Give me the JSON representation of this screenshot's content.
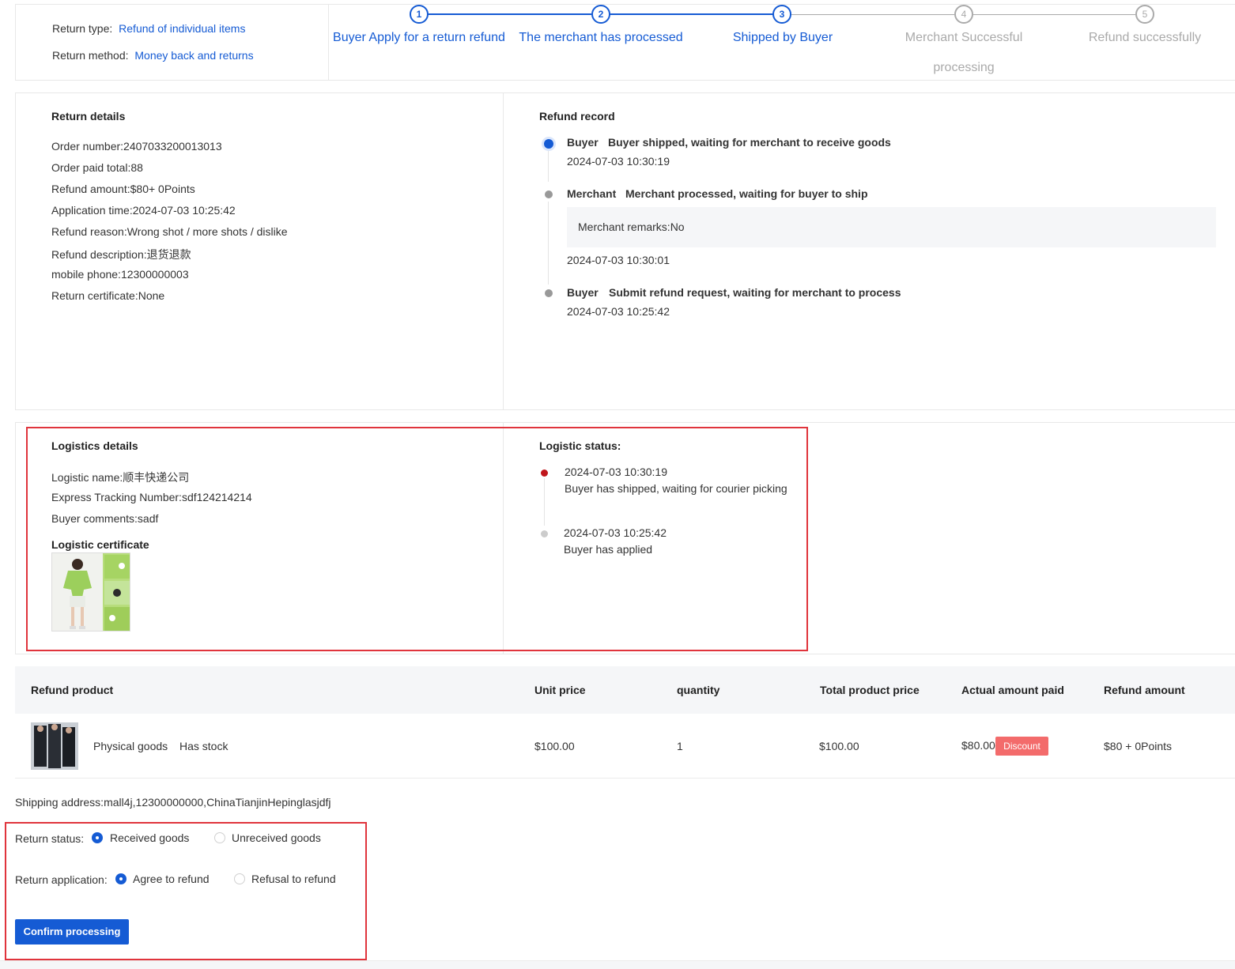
{
  "header": {
    "return_type_label": "Return type:",
    "return_type_value": "Refund of individual items",
    "return_method_label": "Return method:",
    "return_method_value": "Money back and returns"
  },
  "steps": [
    {
      "num": "1",
      "label": "Buyer Apply for a return refund",
      "active": true
    },
    {
      "num": "2",
      "label": "The merchant has processed",
      "active": true
    },
    {
      "num": "3",
      "label": "Shipped by Buyer",
      "active": true
    },
    {
      "num": "4",
      "label": "Merchant Successful",
      "label2": "processing",
      "active": false
    },
    {
      "num": "5",
      "label": "Refund successfully",
      "active": false
    }
  ],
  "return_details": {
    "title": "Return details",
    "rows": [
      "Order number:2407033200013013",
      "Order paid total:88",
      "Refund amount:$80+ 0Points",
      "Application time:2024-07-03 10:25:42",
      "Refund reason:Wrong shot / more shots / dislike",
      "Refund description:退货退款",
      "mobile phone:12300000003",
      "Return certificate:None"
    ]
  },
  "refund_record": {
    "title": "Refund record",
    "entries": [
      {
        "actor": "Buyer",
        "text": "Buyer shipped, waiting for merchant to receive goods",
        "time": "2024-07-03 10:30:19"
      },
      {
        "actor": "Merchant",
        "text": "Merchant processed, waiting for buyer to ship",
        "remark": "Merchant remarks:No",
        "time": "2024-07-03 10:30:01"
      },
      {
        "actor": "Buyer",
        "text": "Submit refund request, waiting for merchant to process",
        "time": "2024-07-03 10:25:42"
      }
    ]
  },
  "logistics": {
    "title": "Logistics details",
    "name": "Logistic name:顺丰快递公司",
    "tracking": "Express Tracking Number:sdf124214214",
    "comments": "Buyer comments:sadf",
    "cert_title": "Logistic certificate",
    "status_title": "Logistic status:",
    "events": [
      {
        "time": "2024-07-03 10:30:19",
        "text": "Buyer has shipped, waiting for courier picking"
      },
      {
        "time": "2024-07-03 10:25:42",
        "text": "Buyer has applied"
      }
    ]
  },
  "table": {
    "headers": [
      "Refund product",
      "Unit price",
      "quantity",
      "Total product price",
      "Actual amount paid",
      "Refund amount"
    ],
    "row": {
      "product": "Physical goods",
      "stock": "Has stock",
      "unit_price": "$100.00",
      "quantity": "1",
      "total": "$100.00",
      "paid": "$80.00",
      "badge": "Discount",
      "refund": "$80 + 0Points"
    }
  },
  "shipping_address": "Shipping address:mall4j,12300000000,ChinaTianjinHepinglasjdfj",
  "form": {
    "status_label": "Return status:",
    "status_options": [
      "Received goods",
      "Unreceived goods"
    ],
    "application_label": "Return application:",
    "application_options": [
      "Agree to refund",
      "Refusal to refund"
    ],
    "confirm_label": "Confirm processing"
  },
  "colors": {
    "accent": "#155bd4",
    "highlight": "#e0343c",
    "badge": "#f36b6b"
  }
}
